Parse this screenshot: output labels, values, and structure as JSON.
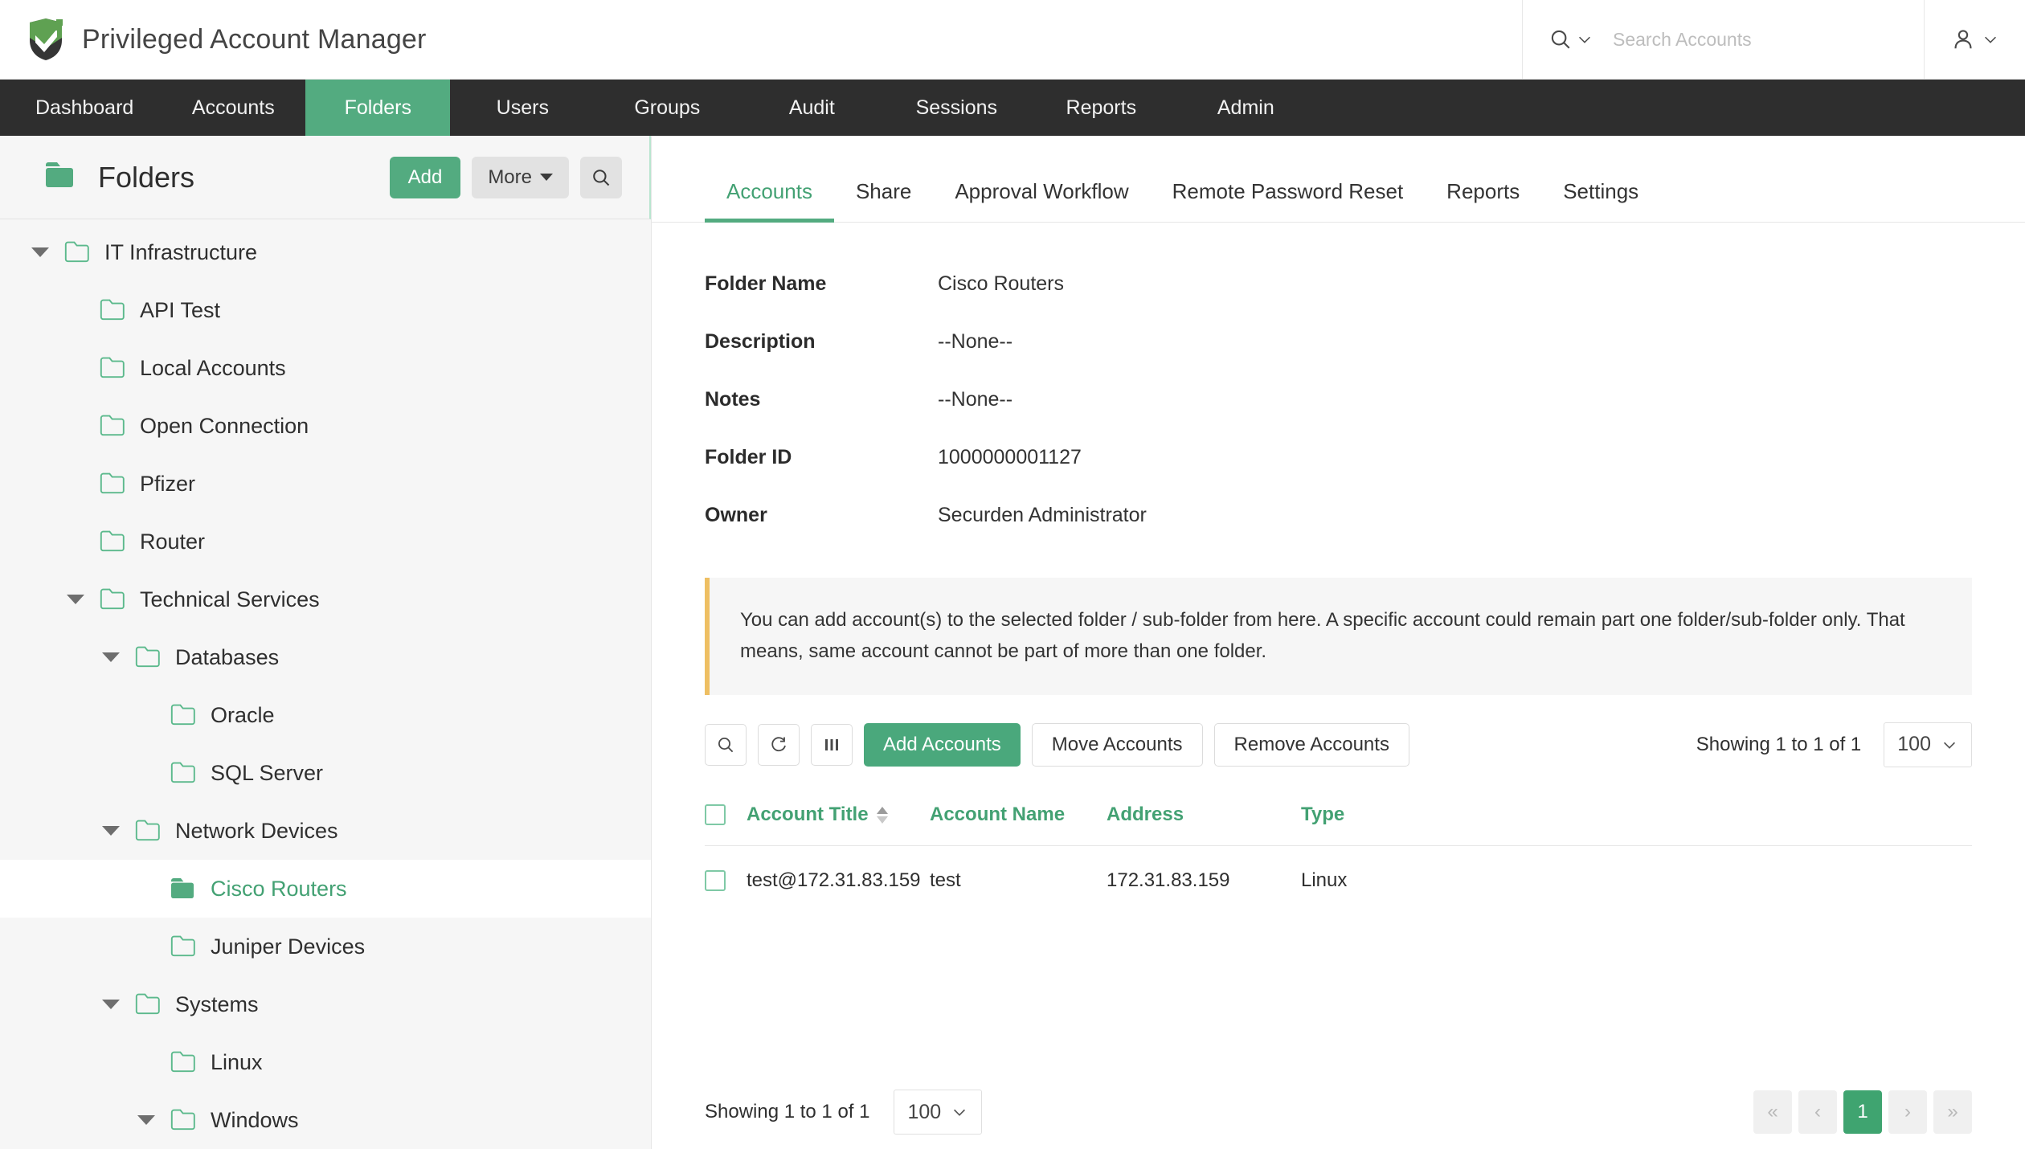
{
  "brand": {
    "title": "Privileged Account Manager",
    "logo_icon": "shield-check-logo",
    "accent_color": "#53ab80",
    "nav_bg_color": "#2e2e2e"
  },
  "header": {
    "search": {
      "icon": "search-icon",
      "caret_icon": "chevron-down-icon",
      "placeholder": "Search Accounts",
      "value": ""
    },
    "user_menu": {
      "icon": "user-icon",
      "caret_icon": "chevron-down-icon"
    }
  },
  "mainnav": {
    "items": [
      {
        "label": "Dashboard",
        "active": false
      },
      {
        "label": "Accounts",
        "active": false
      },
      {
        "label": "Folders",
        "active": true
      },
      {
        "label": "Users",
        "active": false
      },
      {
        "label": "Groups",
        "active": false
      },
      {
        "label": "Audit",
        "active": false
      },
      {
        "label": "Sessions",
        "active": false
      },
      {
        "label": "Reports",
        "active": false
      },
      {
        "label": "Admin",
        "active": false
      }
    ]
  },
  "sidebar": {
    "icon": "folder-filled-icon",
    "title": "Folders",
    "add_label": "Add",
    "more_label": "More",
    "search_icon": "search-icon",
    "tree": [
      {
        "label": "IT Infrastructure",
        "depth": 0,
        "expanded": true,
        "selected": false
      },
      {
        "label": "API Test",
        "depth": 1,
        "expanded": null,
        "selected": false
      },
      {
        "label": "Local Accounts",
        "depth": 1,
        "expanded": null,
        "selected": false
      },
      {
        "label": "Open Connection",
        "depth": 1,
        "expanded": null,
        "selected": false
      },
      {
        "label": "Pfizer",
        "depth": 1,
        "expanded": null,
        "selected": false
      },
      {
        "label": "Router",
        "depth": 1,
        "expanded": null,
        "selected": false
      },
      {
        "label": "Technical Services",
        "depth": 1,
        "expanded": true,
        "selected": false
      },
      {
        "label": "Databases",
        "depth": 2,
        "expanded": true,
        "selected": false
      },
      {
        "label": "Oracle",
        "depth": 3,
        "expanded": null,
        "selected": false
      },
      {
        "label": "SQL Server",
        "depth": 3,
        "expanded": null,
        "selected": false
      },
      {
        "label": "Network Devices",
        "depth": 2,
        "expanded": true,
        "selected": false
      },
      {
        "label": "Cisco Routers",
        "depth": 3,
        "expanded": null,
        "selected": true
      },
      {
        "label": "Juniper Devices",
        "depth": 3,
        "expanded": null,
        "selected": false
      },
      {
        "label": "Systems",
        "depth": 2,
        "expanded": true,
        "selected": false
      },
      {
        "label": "Linux",
        "depth": 3,
        "expanded": null,
        "selected": false
      },
      {
        "label": "Windows",
        "depth": 3,
        "expanded": true,
        "selected": false
      }
    ]
  },
  "main": {
    "tabs": [
      {
        "label": "Accounts",
        "active": true
      },
      {
        "label": "Share",
        "active": false
      },
      {
        "label": "Approval Workflow",
        "active": false
      },
      {
        "label": "Remote Password Reset",
        "active": false
      },
      {
        "label": "Reports",
        "active": false
      },
      {
        "label": "Settings",
        "active": false
      }
    ],
    "details": [
      {
        "label": "Folder Name",
        "value": "Cisco Routers"
      },
      {
        "label": "Description",
        "value": "--None--"
      },
      {
        "label": "Notes",
        "value": "--None--"
      },
      {
        "label": "Folder ID",
        "value": "1000000001127"
      },
      {
        "label": "Owner",
        "value": "Securden Administrator"
      }
    ],
    "notice": {
      "text": "You can add account(s) to the selected folder / sub-folder from here. A specific account could remain part one folder/sub-folder only. That means, same account cannot be part of more than one folder.",
      "accent_color": "#eebf63"
    },
    "toolbar": {
      "search_icon": "search-icon",
      "refresh_icon": "refresh-icon",
      "columns_icon": "columns-icon",
      "add_accounts_label": "Add Accounts",
      "move_accounts_label": "Move Accounts",
      "remove_accounts_label": "Remove Accounts",
      "showing_text": "Showing 1 to 1 of 1",
      "page_size": "100"
    },
    "table": {
      "select_all_checkbox": false,
      "columns": [
        {
          "label": "Account Title",
          "sortable": true
        },
        {
          "label": "Account Name",
          "sortable": false
        },
        {
          "label": "Address",
          "sortable": false
        },
        {
          "label": "Type",
          "sortable": false
        }
      ],
      "rows": [
        {
          "checked": false,
          "account_title": "test@172.31.83.159",
          "account_name": "test",
          "address": "172.31.83.159",
          "type": "Linux"
        }
      ]
    },
    "footer": {
      "showing_text": "Showing 1 to 1 of 1",
      "page_size": "100",
      "pager": {
        "first_label": "«",
        "prev_label": "‹",
        "current_label": "1",
        "next_label": "›",
        "last_label": "»"
      }
    }
  }
}
